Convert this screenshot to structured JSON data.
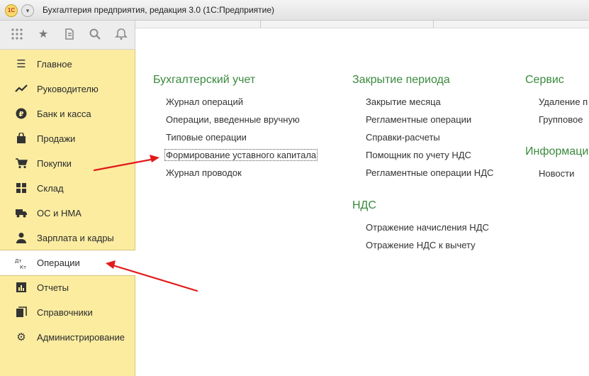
{
  "window": {
    "logo": "1С",
    "title": "Бухгалтерия предприятия, редакция 3.0  (1С:Предприятие)"
  },
  "toolbar": {
    "icons": [
      "apps-grid-icon",
      "star-icon",
      "history-icon",
      "search-icon",
      "bell-icon"
    ]
  },
  "sidebar": {
    "items": [
      {
        "label": "Главное",
        "icon": "menu-lines-icon"
      },
      {
        "label": "Руководителю",
        "icon": "trend-chart-icon"
      },
      {
        "label": "Банк и касса",
        "icon": "ruble-coin-icon"
      },
      {
        "label": "Продажи",
        "icon": "shopping-bag-icon"
      },
      {
        "label": "Покупки",
        "icon": "cart-icon"
      },
      {
        "label": "Склад",
        "icon": "warehouse-grid-icon"
      },
      {
        "label": "ОС и НМА",
        "icon": "truck-icon"
      },
      {
        "label": "Зарплата и кадры",
        "icon": "person-icon"
      },
      {
        "label": "Операции",
        "icon": "dt-kt-icon",
        "icon_text": "Дт Кт",
        "active": true
      },
      {
        "label": "Отчеты",
        "icon": "report-bars-icon"
      },
      {
        "label": "Справочники",
        "icon": "books-icon"
      },
      {
        "label": "Администрирование",
        "icon": "gear-icon"
      }
    ]
  },
  "main": {
    "columns": [
      {
        "sections": [
          {
            "title": "Бухгалтерский учет",
            "links": [
              "Журнал операций",
              "Операции, введенные вручную",
              "Типовые операции",
              "Формирование уставного капитала",
              "Журнал проводок"
            ]
          }
        ]
      },
      {
        "sections": [
          {
            "title": "Закрытие периода",
            "links": [
              "Закрытие месяца",
              "Регламентные операции",
              "Справки-расчеты",
              "Помощник по учету НДС",
              "Регламентные операции НДС"
            ]
          },
          {
            "title": "НДС",
            "links": [
              "Отражение начисления НДС",
              "Отражение НДС к вычету"
            ]
          }
        ]
      },
      {
        "sections": [
          {
            "title": "Сервис",
            "links": [
              "Удаление п",
              "Групповое"
            ]
          },
          {
            "title": "Информаци",
            "links": [
              "Новости"
            ]
          }
        ]
      }
    ],
    "selected_link": "Формирование уставного капитала"
  },
  "annotations": {
    "arrow_color": "#e21a1a"
  }
}
